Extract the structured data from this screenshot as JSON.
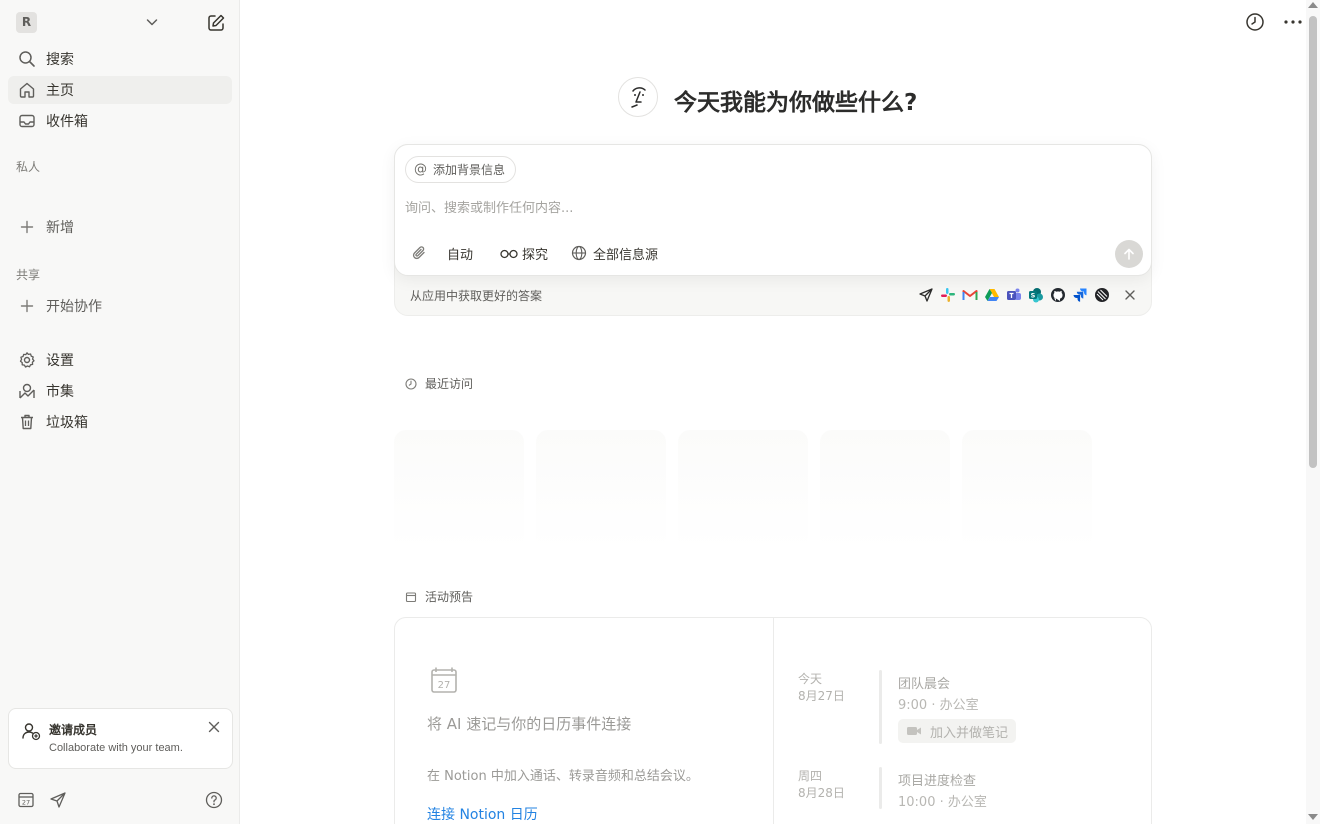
{
  "sidebar": {
    "workspace_initial": "R",
    "nav": [
      {
        "label": "搜索",
        "icon": "search-icon"
      },
      {
        "label": "主页",
        "icon": "home-icon"
      },
      {
        "label": "收件箱",
        "icon": "inbox-icon"
      }
    ],
    "private_label": "私人",
    "add_new_label": "新增",
    "shared_label": "共享",
    "start_collab_label": "开始协作",
    "bottom_nav": [
      {
        "label": "设置",
        "icon": "settings-icon"
      },
      {
        "label": "市集",
        "icon": "marketplace-icon"
      },
      {
        "label": "垃圾箱",
        "icon": "trash-icon"
      }
    ],
    "invite": {
      "title": "邀请成员",
      "subtitle": "Collaborate with your team."
    }
  },
  "main": {
    "title": "今天我能为你做些什么?",
    "prompt": {
      "context_chip": "添加背景信息",
      "placeholder": "询问、搜索或制作任何内容...",
      "mode_label": "自动",
      "research_label": "探究",
      "sources_label": "全部信息源"
    },
    "apps_bar": {
      "text": "从应用中获取更好的答案",
      "apps": [
        "send-app-icon",
        "slack-icon",
        "gmail-icon",
        "google-drive-icon",
        "teams-icon",
        "sharepoint-icon",
        "github-icon",
        "jira-icon",
        "linear-icon"
      ]
    },
    "recent": {
      "label": "最近访问"
    },
    "events": {
      "label": "活动预告",
      "promo_title": "将 AI 速记与你的日历事件连接",
      "promo_desc": "在 Notion 中加入通话、转录音频和总结会议。",
      "promo_link": "连接 Notion 日历",
      "days": [
        {
          "day": "今天",
          "date": "8月27日",
          "event_title": "团队晨会",
          "event_meta": "9:00 · 办公室",
          "join_label": "加入并做笔记"
        },
        {
          "day": "周四",
          "date": "8月28日",
          "event_title": "项目进度检查",
          "event_meta": "10:00 · 办公室"
        }
      ]
    }
  },
  "colors": {
    "sidebar_bg": "#f8f8f7",
    "link": "#2383e2",
    "text": "#37352f"
  }
}
